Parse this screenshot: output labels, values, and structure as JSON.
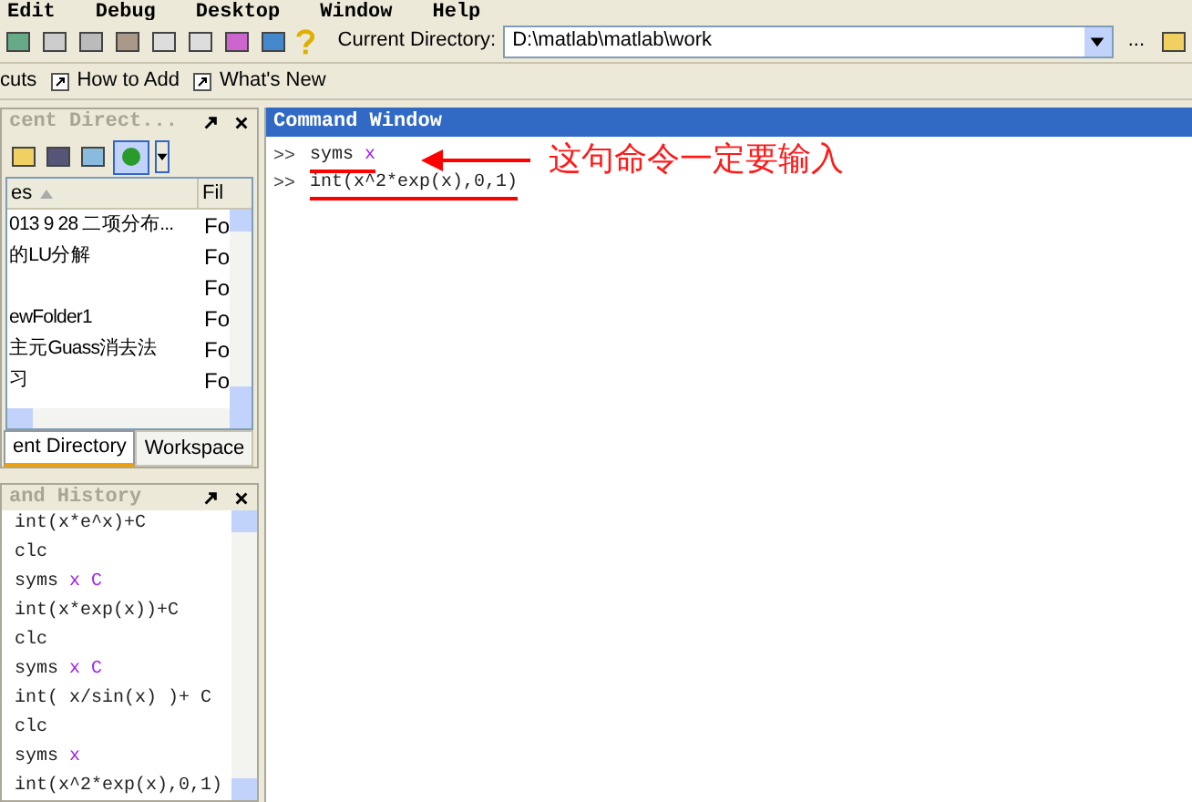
{
  "menu": [
    "Edit",
    "Debug",
    "Desktop",
    "Window",
    "Help"
  ],
  "toolbar": {
    "directory_label": "Current Directory:",
    "directory_value": "D:\\matlab\\matlab\\work",
    "browse": "..."
  },
  "shortcuts": [
    "cuts",
    "How to Add",
    "What's New"
  ],
  "current_directory": {
    "title": "cent Direct...",
    "columns": [
      "es",
      "Fil"
    ],
    "rows": [
      {
        "name": "013 9 28 二项分布...",
        "type": "Fo"
      },
      {
        "name": "的LU分解",
        "type": "Fo"
      },
      {
        "type": "Fo"
      },
      {
        "name": "ewFolder1",
        "type": "Fo"
      },
      {
        "name": "主元Guass消去法",
        "type": "Fo"
      },
      {
        "name": "习",
        "type": "Fo"
      }
    ],
    "tabs": [
      {
        "label": "ent Directory",
        "selected": true
      },
      {
        "label": "Workspace",
        "selected": false
      }
    ]
  },
  "command_history": {
    "title": "and History",
    "lines": [
      [
        {
          "text": "int(x*e^x)+C",
          "kind": "code"
        }
      ],
      [
        {
          "text": "clc",
          "kind": "code"
        }
      ],
      [
        {
          "text": "syms",
          "kind": "code"
        },
        {
          "text": "x C",
          "kind": "arg"
        }
      ],
      [
        {
          "text": "int(x*exp(x))+C",
          "kind": "code"
        }
      ],
      [
        {
          "text": "clc",
          "kind": "code"
        }
      ],
      [
        {
          "text": "syms",
          "kind": "code"
        },
        {
          "text": "x C",
          "kind": "arg"
        }
      ],
      [
        {
          "text": "int( x/sin(x) )+ C",
          "kind": "code"
        }
      ],
      [
        {
          "text": "clc",
          "kind": "code"
        }
      ],
      [
        {
          "text": "syms",
          "kind": "code"
        },
        {
          "text": "x",
          "kind": "arg"
        }
      ],
      [
        {
          "text": "int(x^2*exp(x),0,1)",
          "kind": "code"
        }
      ]
    ]
  },
  "command_window": {
    "title": "Command Window",
    "lines": [
      {
        "prompt": ">>",
        "underlined": true,
        "parts": [
          {
            "text": "syms",
            "kind": "code"
          },
          {
            "text": "x",
            "kind": "arg"
          }
        ]
      },
      {
        "prompt": ">>",
        "underlined": true,
        "parts": [
          {
            "text": "int(x^2*exp(x),0,1)",
            "kind": "code"
          }
        ]
      }
    ],
    "annotation": "这句命令一定要输入"
  }
}
